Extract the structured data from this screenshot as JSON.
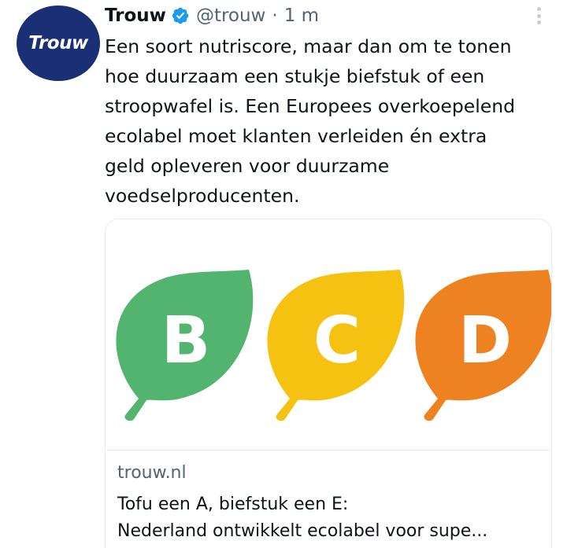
{
  "account": {
    "avatar_text": "Trouw",
    "display_name": "Trouw",
    "handle": "@trouw",
    "separator": "·",
    "time": "1 m",
    "verified": true
  },
  "tweet": {
    "text_lines": [
      "Een soort nutriscore, maar dan om te tonen",
      "hoe duurzaam een stukje biefstuk of een",
      "stroopwafel is. Een Europees overkoepelend",
      "ecolabel moet klanten verleiden én extra",
      "geld opleveren voor duurzame",
      "voedselproducenten."
    ]
  },
  "card": {
    "image": {
      "leaves": [
        {
          "letter": "B",
          "color": "#52b46f"
        },
        {
          "letter": "C",
          "color": "#f5c211"
        },
        {
          "letter": "D",
          "color": "#ee8120"
        }
      ]
    },
    "domain": "trouw.nl",
    "title_lines": [
      "Tofu een A, biefstuk een E:",
      "Nederland ontwikkelt ecolabel voor supe..."
    ]
  },
  "icons": {
    "verified": "verified-badge-icon",
    "more": "more-options-icon"
  },
  "colors": {
    "avatar_bg": "#1a2f74",
    "verified": "#1d9bf0",
    "muted_text": "#536471"
  }
}
